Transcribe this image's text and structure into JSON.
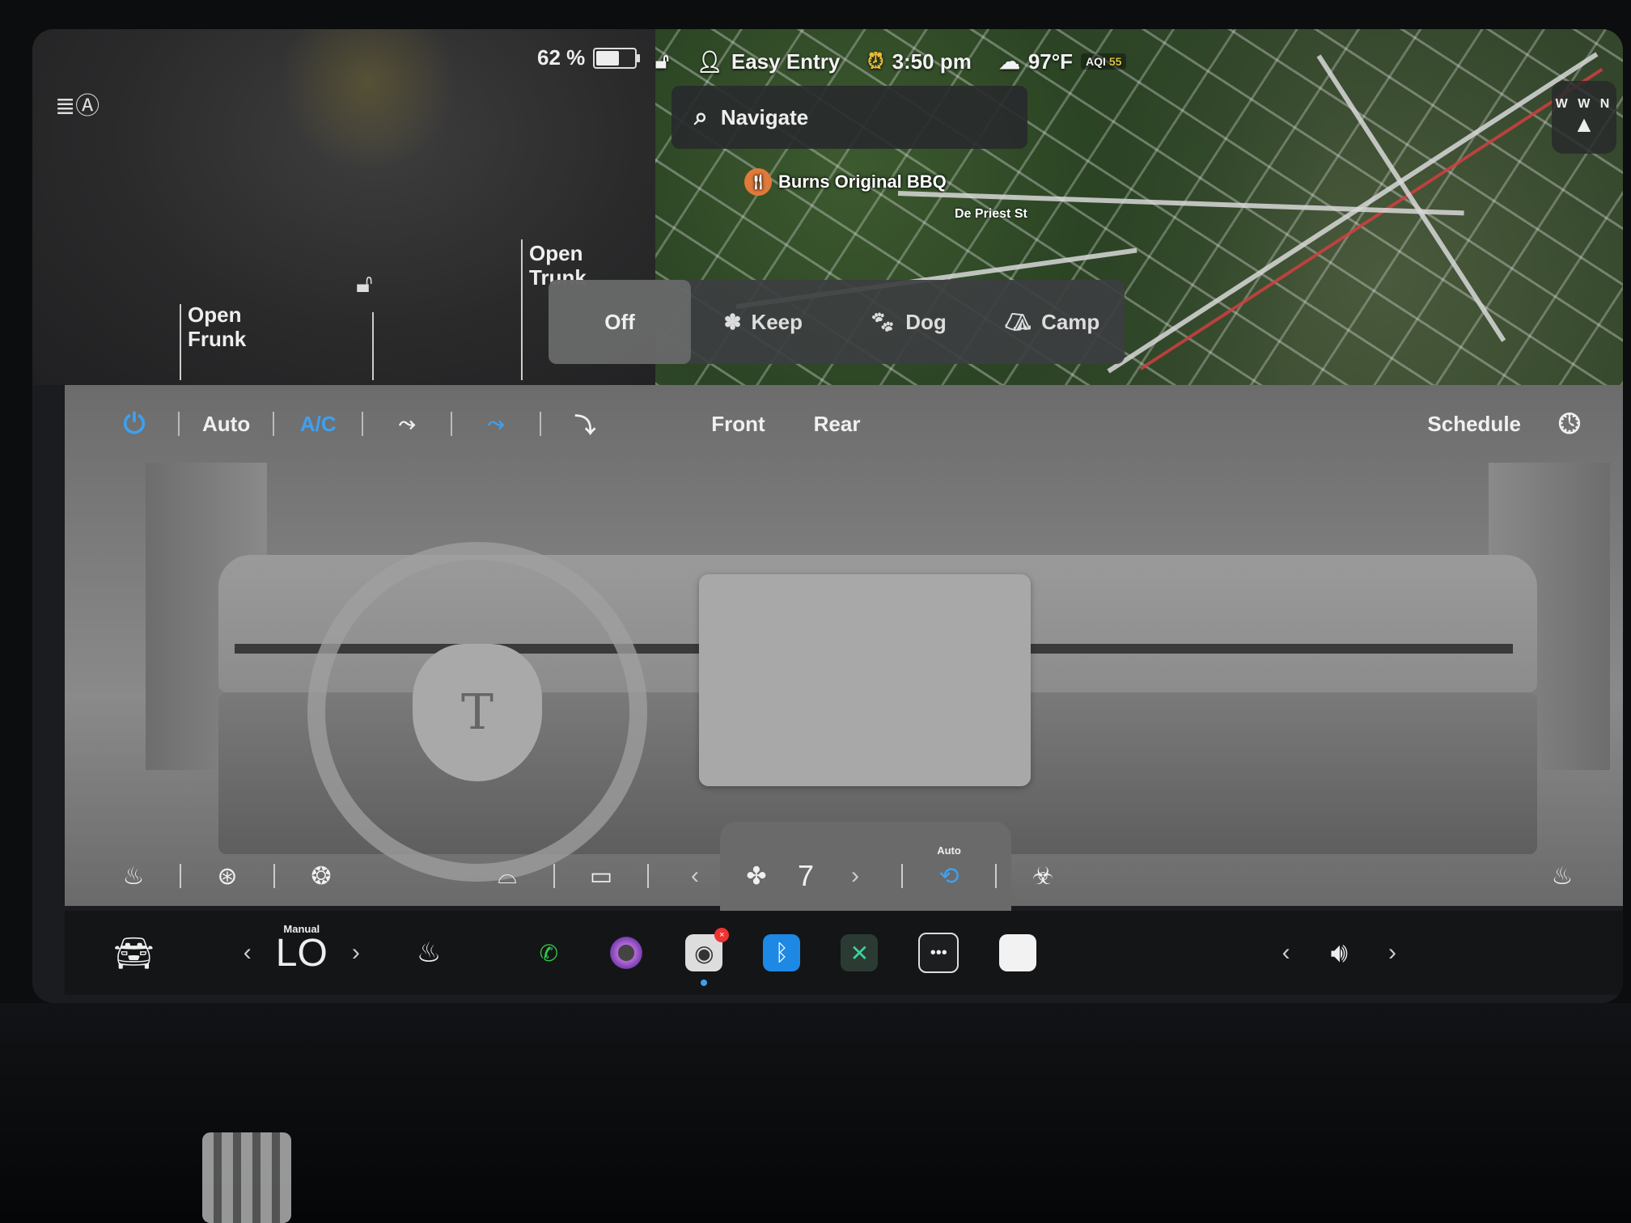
{
  "status": {
    "battery_percent_text": "62 %",
    "battery_level": 0.62,
    "profile": "Easy Entry",
    "time": "3:50 pm",
    "temperature": "97°F",
    "aqi_label": "AQI",
    "aqi_value": "55"
  },
  "car_panel": {
    "frunk_label": "Open\nFrunk",
    "trunk_label": "Open\nTrunk"
  },
  "map": {
    "search_placeholder": "Navigate",
    "poi_name": "Burns Original BBQ",
    "street_name": "De Priest St",
    "compass_heading": "W W N"
  },
  "climate_mode": {
    "options": [
      {
        "label": "Off",
        "active": true
      },
      {
        "label": "Keep",
        "active": false
      },
      {
        "label": "Dog",
        "active": false
      },
      {
        "label": "Camp",
        "active": false
      }
    ]
  },
  "climate_toolbar": {
    "auto_label": "Auto",
    "ac_label": "A/C",
    "front_label": "Front",
    "rear_label": "Rear",
    "schedule_label": "Schedule"
  },
  "climate_bottom": {
    "fan_speed": "7",
    "recirc_label": "Auto"
  },
  "taskbar": {
    "temp_mode": "Manual",
    "temp_value": "LO"
  },
  "colors": {
    "accent_blue": "#3ea0f0",
    "phone_green": "#2ec94a",
    "bluetooth_blue": "#1e88e5"
  }
}
